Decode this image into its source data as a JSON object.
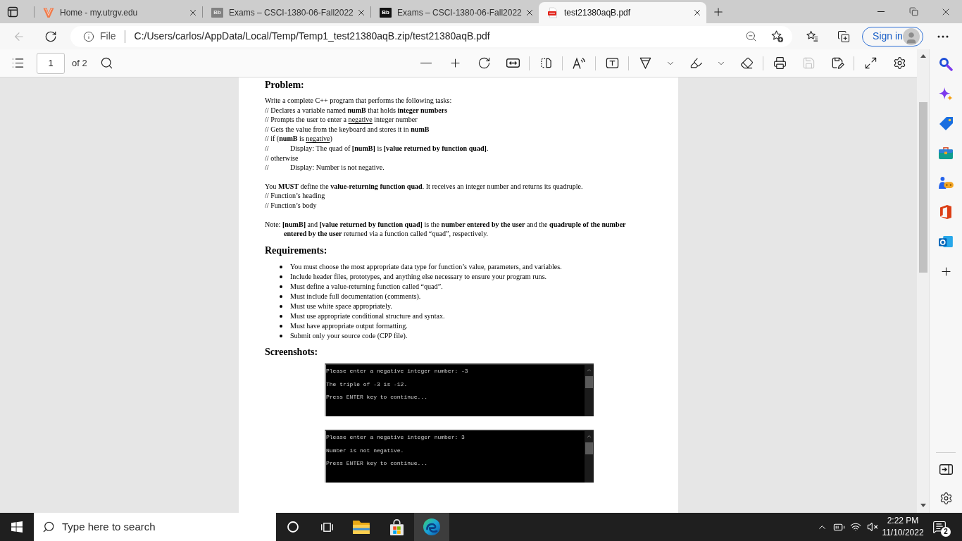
{
  "tabs": [
    {
      "title": "Home - my.utrgv.edu",
      "kind": "university",
      "faded": false,
      "selected": false
    },
    {
      "title": "Exams – CSCI-1380-06-Fall2022",
      "kind": "blackboard",
      "icon_text": "Bb",
      "faded": true,
      "selected": false
    },
    {
      "title": "Exams – CSCI-1380-06-Fall2022",
      "kind": "blackboard",
      "icon_text": "Bb",
      "faded": false,
      "selected": false
    },
    {
      "title": "test21380aqB.pdf",
      "kind": "pdf",
      "faded": false,
      "selected": true
    }
  ],
  "toolbar": {
    "back_disabled": true,
    "site_label": "File",
    "url": "C:/Users/carlos/AppData/Local/Temp/Temp1_test21380aqB.zip/test21380aqB.pdf",
    "sign_in": "Sign in"
  },
  "pdf_toolbar": {
    "page": "1",
    "page_count": "of 2",
    "save_disabled": true
  },
  "document": {
    "sections": [
      {
        "kind": "text",
        "heading": "Problem:",
        "paragraphs": [
          {
            "lines": [
              {
                "kind": "plain",
                "parts": [
                  {
                    "text": "Write a complete C++ program that performs the following tasks:",
                    "underline": false
                  }
                ]
              },
              {
                "kind": "plain",
                "parts": [
                  {
                    "text": "// Declares a variable named **numB** that holds **integer numbers**",
                    "underline": false
                  }
                ]
              },
              {
                "kind": "plain",
                "parts": [
                  {
                    "text": "// Prompts the user to enter a ",
                    "underline": false
                  },
                  {
                    "text": "negative",
                    "underline": true
                  },
                  {
                    "text": " integer number",
                    "underline": false
                  }
                ]
              },
              {
                "kind": "plain",
                "parts": [
                  {
                    "text": "// Gets the value from the keyboard and stores it in **numB**",
                    "underline": false
                  }
                ]
              },
              {
                "kind": "plain",
                "parts": [
                  {
                    "text": "// if (**numB** is ",
                    "underline": false
                  },
                  {
                    "text": "negative",
                    "underline": true
                  },
                  {
                    "text": ")",
                    "underline": false
                  }
                ]
              },
              {
                "kind": "tabbed",
                "marker": "//",
                "parts": [
                  {
                    "text": "Display: The quad of **[numB]** is **[value returned by function quad]**.",
                    "underline": false
                  }
                ]
              },
              {
                "kind": "plain",
                "parts": [
                  {
                    "text": "// otherwise",
                    "underline": false
                  }
                ]
              },
              {
                "kind": "tabbed",
                "marker": "//",
                "parts": [
                  {
                    "text": "Display: Number is not negative.",
                    "underline": false
                  }
                ]
              }
            ]
          },
          {
            "lines": [
              {
                "kind": "plain",
                "parts": [
                  {
                    "text": "You **MUST** define the **value-returning function quad**. It receives an integer number and returns its quadruple.",
                    "underline": false
                  }
                ]
              },
              {
                "kind": "plain",
                "parts": [
                  {
                    "text": "// Function’s heading",
                    "underline": false
                  }
                ]
              },
              {
                "kind": "plain",
                "parts": [
                  {
                    "text": "// Function’s body",
                    "underline": false
                  }
                ]
              }
            ]
          },
          {
            "lines": [
              {
                "kind": "hanging",
                "parts": [
                  {
                    "text": "Note: **[numB]** and **[value returned by function quad]** is the **number entered by the user** and the **quadruple of the number entered by the user** returned via a function called “quad”, respectively.",
                    "underline": false
                  }
                ]
              }
            ]
          }
        ]
      },
      {
        "kind": "bullets",
        "heading": "Requirements:",
        "items": [
          "You must choose the most appropriate data type for function’s value, parameters, and variables.",
          "Include header files, prototypes, and anything else necessary to ensure your program runs.",
          "Must define a value-returning function called “quad”.",
          "Must include full documentation (comments).",
          "Must use white space appropriately.",
          "Must use appropriate conditional structure and syntax.",
          "Must have appropriate output formatting.",
          "Submit only your source code (CPP file)."
        ]
      },
      {
        "kind": "screenshots",
        "heading": "Screenshots:",
        "consoles": [
          {
            "lines": [
              "Please enter a negative integer number: -3",
              "The triple of -3 is -12.",
              "Press ENTER key to continue..."
            ]
          },
          {
            "lines": [
              "Please enter a negative integer number: 3",
              "Number is not negative.",
              "Press ENTER key to continue..."
            ]
          }
        ]
      }
    ]
  },
  "taskbar": {
    "search_placeholder": "Type here to search",
    "apps": [
      {
        "kind": "cortana",
        "selected": false
      },
      {
        "kind": "taskview",
        "selected": false
      },
      {
        "kind": "explorer",
        "selected": false
      },
      {
        "kind": "store",
        "selected": false
      },
      {
        "kind": "edge",
        "selected": true
      }
    ],
    "time": "2:22 PM",
    "date": "11/10/2022",
    "notification_count": "2"
  }
}
